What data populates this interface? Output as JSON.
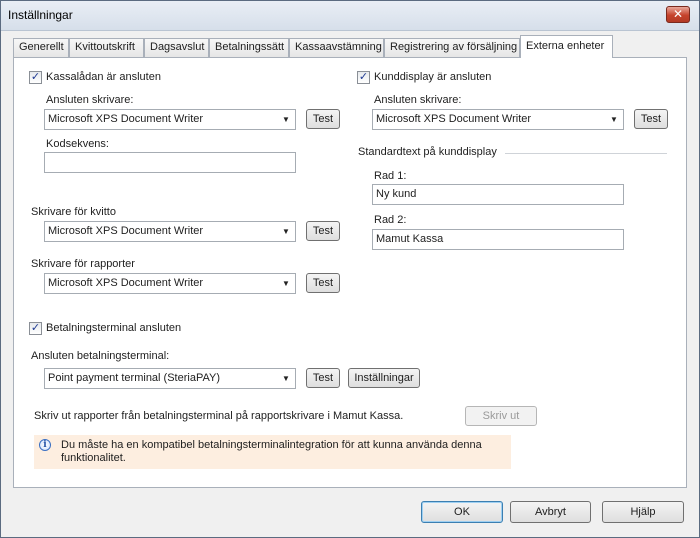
{
  "window": {
    "title": "Inställningar",
    "close_glyph": "✕"
  },
  "tabs": [
    {
      "label": "Generellt"
    },
    {
      "label": "Kvittoutskrift"
    },
    {
      "label": "Dagsavslut"
    },
    {
      "label": "Betalningssätt"
    },
    {
      "label": "Kassaavstämning"
    },
    {
      "label": "Registrering av försäljning"
    },
    {
      "label": "Externa enheter",
      "active": true
    }
  ],
  "cash_drawer": {
    "checkbox_label": "Kassalådan är ansluten",
    "checked": true,
    "printer_label": "Ansluten skrivare:",
    "printer_value": "Microsoft XPS Document Writer",
    "test_label": "Test",
    "code_label": "Kodsekvens:",
    "code_value": ""
  },
  "receipt_printer": {
    "label": "Skrivare för kvitto",
    "value": "Microsoft XPS Document Writer",
    "test_label": "Test"
  },
  "report_printer": {
    "label": "Skrivare för rapporter",
    "value": "Microsoft XPS Document Writer",
    "test_label": "Test"
  },
  "customer_display": {
    "checkbox_label": "Kunddisplay är ansluten",
    "checked": true,
    "printer_label": "Ansluten skrivare:",
    "printer_value": "Microsoft XPS Document Writer",
    "test_label": "Test",
    "group_label": "Standardtext på kunddisplay",
    "row1_label": "Rad 1:",
    "row1_value": "Ny kund",
    "row2_label": "Rad 2:",
    "row2_value": "Mamut Kassa"
  },
  "payment_terminal": {
    "checkbox_label": "Betalningsterminal ansluten",
    "checked": true,
    "terminal_label": "Ansluten betalningsterminal:",
    "terminal_value": "Point payment terminal (SteriaPAY)",
    "test_label": "Test",
    "settings_label": "Inställningar",
    "print_text": "Skriv ut rapporter från betalningsterminal på rapportskrivare i Mamut Kassa.",
    "print_button": "Skriv ut",
    "info_text": "Du måste ha en kompatibel betalningsterminalintegration för att kunna använda denna funktionalitet."
  },
  "footer": {
    "ok": "OK",
    "cancel": "Avbryt",
    "help": "Hjälp"
  },
  "glyphs": {
    "check": "✓",
    "dropdown_arrow": "▼",
    "info": "i"
  },
  "colors": {
    "info_background": "#fdeee0",
    "close_button": "#c6432c"
  }
}
